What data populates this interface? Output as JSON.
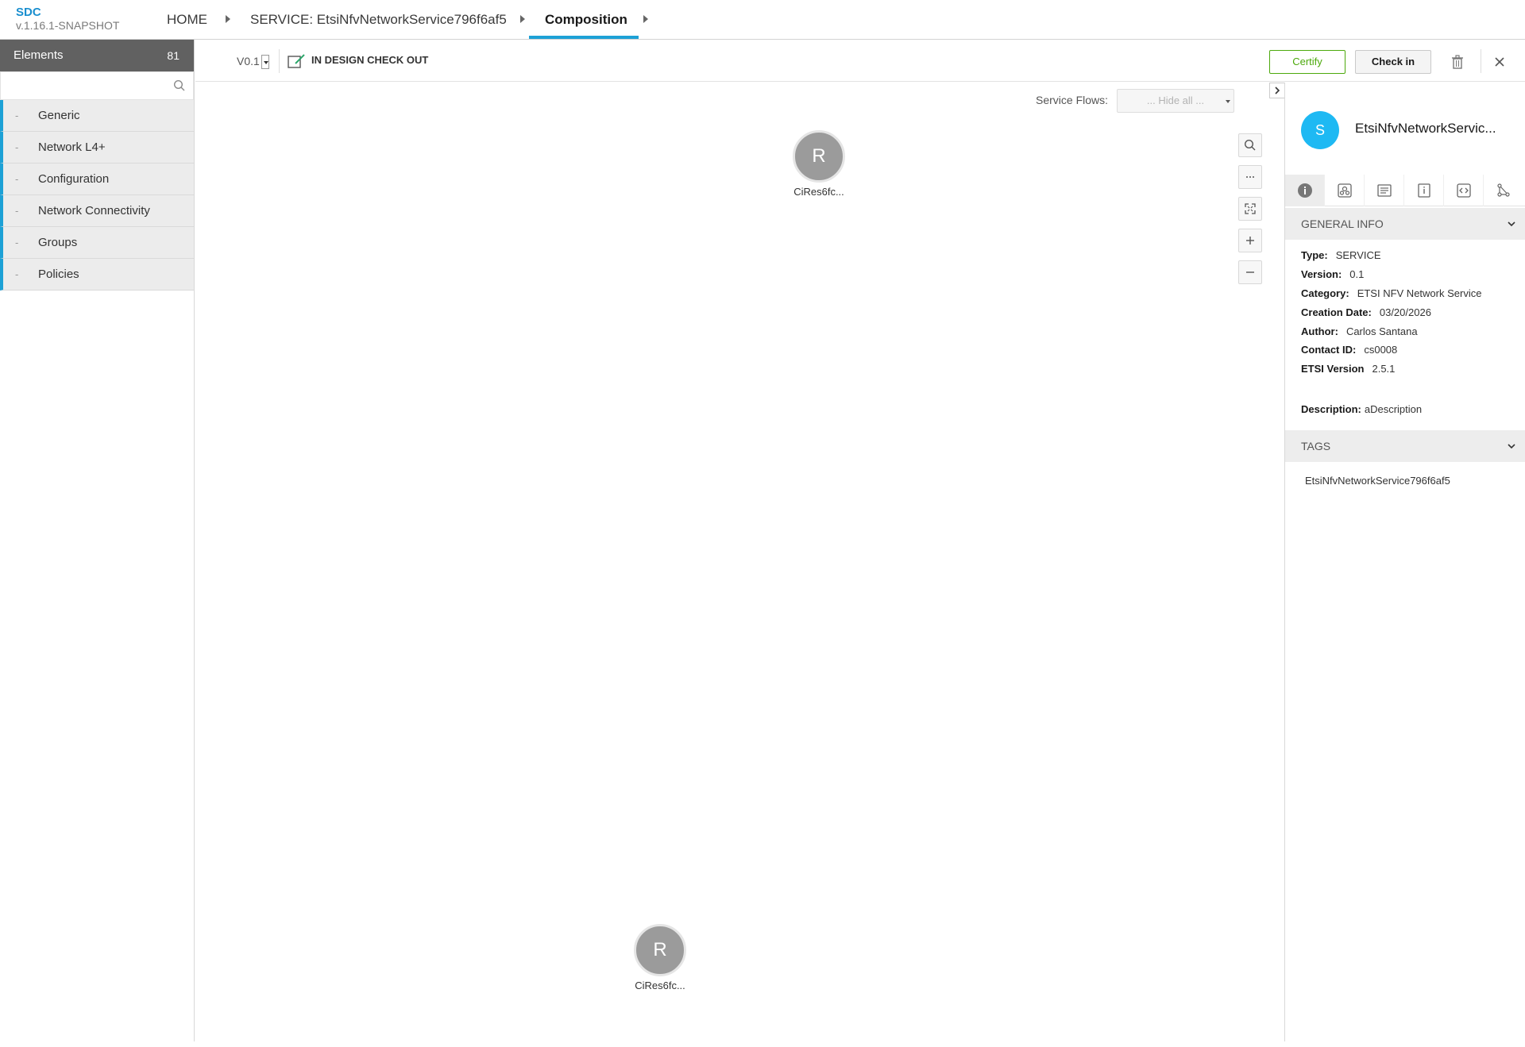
{
  "app": {
    "name": "SDC",
    "version": "v.1.16.1-SNAPSHOT"
  },
  "breadcrumbs": [
    {
      "label": "HOME"
    },
    {
      "label": "SERVICE: EtsiNfvNetworkService796f6af5"
    },
    {
      "label": "Composition"
    }
  ],
  "palette": {
    "title": "Elements",
    "count": "81",
    "search_placeholder": "",
    "categories": [
      {
        "dash": "-",
        "label": "Generic"
      },
      {
        "dash": "-",
        "label": "Network L4+"
      },
      {
        "dash": "-",
        "label": "Configuration"
      },
      {
        "dash": "-",
        "label": "Network Connectivity"
      },
      {
        "dash": "-",
        "label": "Groups"
      },
      {
        "dash": "-",
        "label": "Policies"
      }
    ]
  },
  "toolbar": {
    "version": "V0.1",
    "status": "IN DESIGN CHECK OUT",
    "certify_label": "Certify",
    "checkin_label": "Check in"
  },
  "canvas": {
    "service_flows_label": "Service Flows:",
    "service_flows_value": "... Hide all ...",
    "nodes": [
      {
        "letter": "R",
        "label": "CiRes6fc..."
      },
      {
        "letter": "R",
        "label": "CiRes6fc..."
      }
    ]
  },
  "details": {
    "avatar_letter": "S",
    "service_name": "EtsiNfvNetworkServic...",
    "general_info_title": "GENERAL INFO",
    "fields": {
      "type": {
        "label": "Type:",
        "value": "SERVICE"
      },
      "version": {
        "label": "Version:",
        "value": "0.1"
      },
      "category": {
        "label": "Category:",
        "value": "ETSI NFV Network Service"
      },
      "creation_date": {
        "label": "Creation Date:",
        "value": "03/20/2026"
      },
      "author": {
        "label": "Author:",
        "value": "Carlos Santana"
      },
      "contact_id": {
        "label": "Contact ID:",
        "value": "cs0008"
      },
      "etsi_version": {
        "label": "ETSI Version",
        "value": "2.5.1"
      },
      "description": {
        "label": "Description:",
        "value": "aDescription"
      }
    },
    "tags_title": "TAGS",
    "tags": [
      "EtsiNfvNetworkService796f6af5"
    ]
  },
  "colors": {
    "accent": "#1da1d6",
    "certify": "#4ca90c",
    "avatar": "#1eb9f3",
    "node": "#9b9b9b",
    "palette_header": "#616161"
  }
}
